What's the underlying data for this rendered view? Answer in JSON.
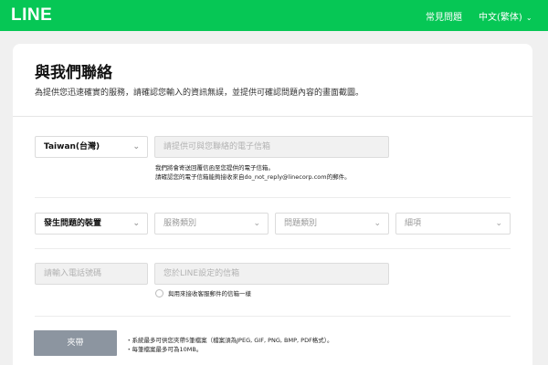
{
  "header": {
    "logo": "LINE",
    "faq": "常見問題",
    "language": "中文(繁体)",
    "brand_color": "#06c755"
  },
  "page": {
    "title": "與我們聯絡",
    "subtitle": "為提供您迅速確實的服務，請確認您輸入的資訊無誤，並提供可確認問題內容的畫面截圖。"
  },
  "form": {
    "country_value": "Taiwan(台灣)",
    "email_placeholder": "請提供可與您聯絡的電子信箱",
    "email_hint_1": "我們將會寄送回覆信函至您提供的電子信箱。",
    "email_hint_2": "請確認您的電子信箱能夠接收來自do_not_reply@linecorp.com的郵件。",
    "device_value": "發生問題的裝置",
    "service_category": "服務類別",
    "issue_category": "問題類別",
    "details": "細項",
    "phone_placeholder": "請輸入電話號碼",
    "line_email_placeholder": "您於LINE設定的信箱",
    "same_email_label": "與用來接收客服郵件的信箱一樣",
    "attach_button": "夾帶",
    "attach_note_1": "・系統最多可供您夾帶5筆檔案（檔案須為JPEG, GIF, PNG, BMP, PDF格式）。",
    "attach_note_2": "・每筆檔案最多可為10MB。"
  },
  "icons": {
    "dropdown": "chevron-down-icon",
    "radio": "radio-unchecked-icon"
  }
}
